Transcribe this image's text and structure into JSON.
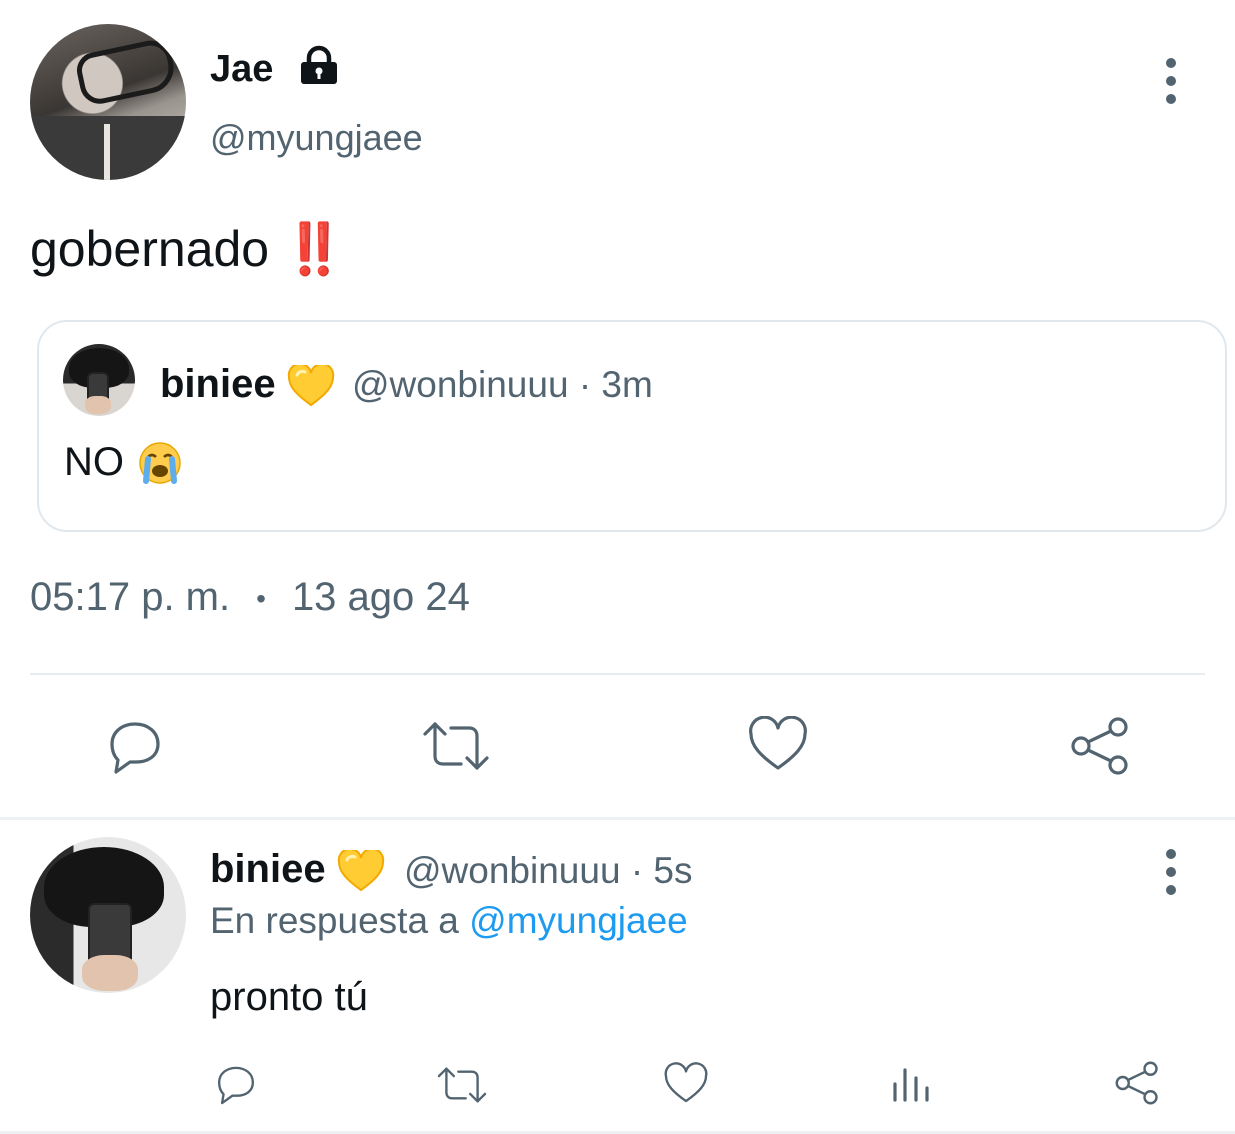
{
  "main_tweet": {
    "author_name": "Jae",
    "author_handle": "@myungjaee",
    "text": "gobernado",
    "emoji": "‼️",
    "time": "05:17 p. m.",
    "separator": "•",
    "date": "13 ago 24",
    "locked": true
  },
  "quoted_tweet": {
    "author_name": "biniee",
    "author_emoji": "💛",
    "author_handle": "@wonbinuuu",
    "age": "· 3m",
    "text": "NO",
    "text_emoji": "😭"
  },
  "reply_tweet": {
    "author_name": "biniee",
    "author_emoji": "💛",
    "author_handle": "@wonbinuuu",
    "age": "· 5s",
    "reply_prefix": "En respuesta a",
    "reply_mention": "@myungjaee",
    "text": "pronto tú"
  },
  "icons": {
    "main_actions": [
      "reply-icon",
      "retweet-icon",
      "like-icon",
      "share-icon"
    ],
    "reply_actions": [
      "reply-icon",
      "retweet-icon",
      "like-icon",
      "views-icon",
      "share-icon"
    ]
  },
  "colors": {
    "text_primary": "#0f1419",
    "text_secondary": "#536471",
    "mention": "#1d9bf0",
    "emphasis": "#e0202b",
    "border": "#e1e8ed"
  }
}
